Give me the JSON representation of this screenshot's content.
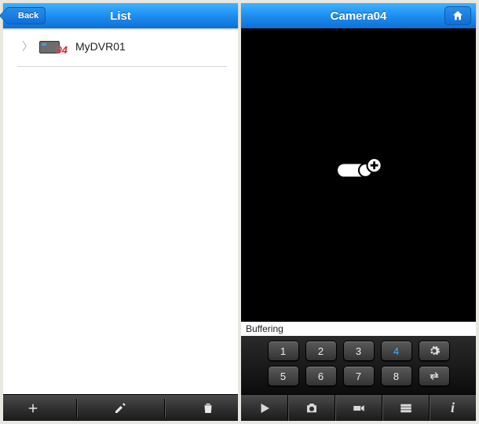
{
  "left": {
    "back_label": "Back",
    "title": "List",
    "items": [
      {
        "label": "MyDVR01",
        "badge": "04"
      }
    ],
    "toolbar": {
      "add": "add-icon",
      "edit": "edit-icon",
      "delete": "trash-icon"
    }
  },
  "right": {
    "title": "Camera04",
    "status": "Buffering",
    "keypad": {
      "rows": [
        [
          "1",
          "2",
          "3",
          "4"
        ],
        [
          "5",
          "6",
          "7",
          "8"
        ]
      ],
      "selected": "4",
      "side_top": "gear-icon",
      "side_bottom": "swap-icon"
    },
    "toolbar": {
      "play": "play-icon",
      "snapshot": "camera-icon",
      "record": "camcorder-icon",
      "settings": "sliders-icon",
      "info": "i"
    }
  }
}
